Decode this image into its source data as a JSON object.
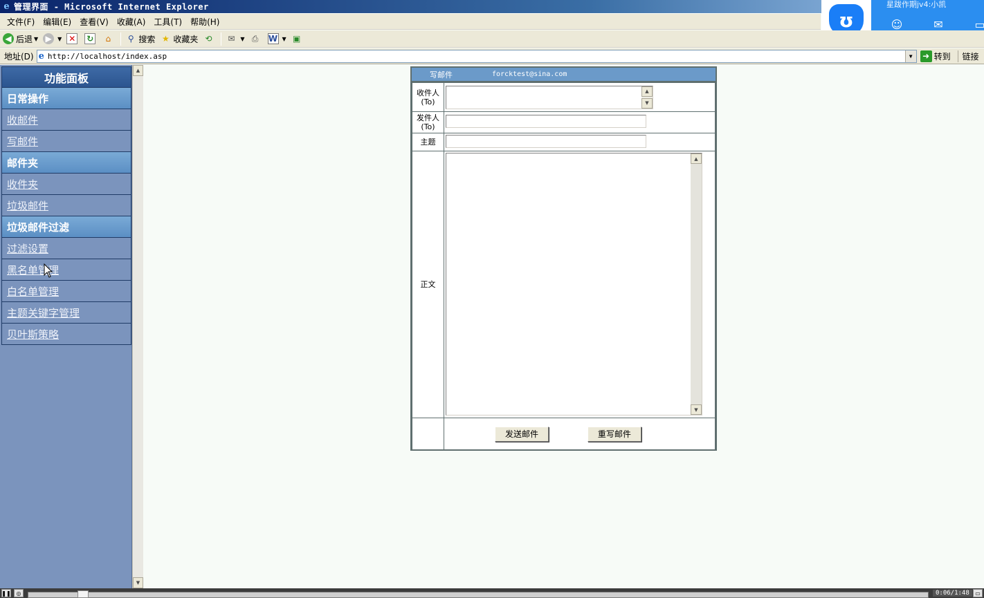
{
  "window": {
    "title": "管理界面 - Microsoft Internet Explorer"
  },
  "overlay_widget": {
    "name": "星跋作期jv4:小凯"
  },
  "menu": [
    "文件(F)",
    "编辑(E)",
    "查看(V)",
    "收藏(A)",
    "工具(T)",
    "帮助(H)"
  ],
  "toolbar": {
    "back": "后退",
    "search": "搜索",
    "favorites": "收藏夹"
  },
  "address": {
    "label": "地址(D)",
    "url": "http://localhost/index.asp",
    "go": "转到",
    "links": "链接"
  },
  "sidebar": {
    "title": "功能面板",
    "items": [
      {
        "label": "日常操作",
        "kind": "cat"
      },
      {
        "label": "收邮件",
        "kind": "link"
      },
      {
        "label": "写邮件",
        "kind": "link"
      },
      {
        "label": "邮件夹",
        "kind": "cat"
      },
      {
        "label": "收件夹",
        "kind": "link"
      },
      {
        "label": "垃圾邮件",
        "kind": "link"
      },
      {
        "label": "垃圾邮件过滤",
        "kind": "cat"
      },
      {
        "label": "过滤设置",
        "kind": "link"
      },
      {
        "label": "黑名单管理",
        "kind": "link"
      },
      {
        "label": "白名单管理",
        "kind": "link"
      },
      {
        "label": "主题关键字管理",
        "kind": "link"
      },
      {
        "label": "贝叶斯策略",
        "kind": "link"
      }
    ]
  },
  "compose": {
    "header_title": "写邮件",
    "account": "forcktest@sina.com",
    "to_label_1": "收件人",
    "to_label_2": "(To)",
    "from_label_1": "发件人",
    "from_label_2": "(To)",
    "subject_label": "主题",
    "body_label": "正文",
    "send_button": "发送邮件",
    "reset_button": "重写邮件"
  },
  "player": {
    "time": "0:06/1:48"
  }
}
